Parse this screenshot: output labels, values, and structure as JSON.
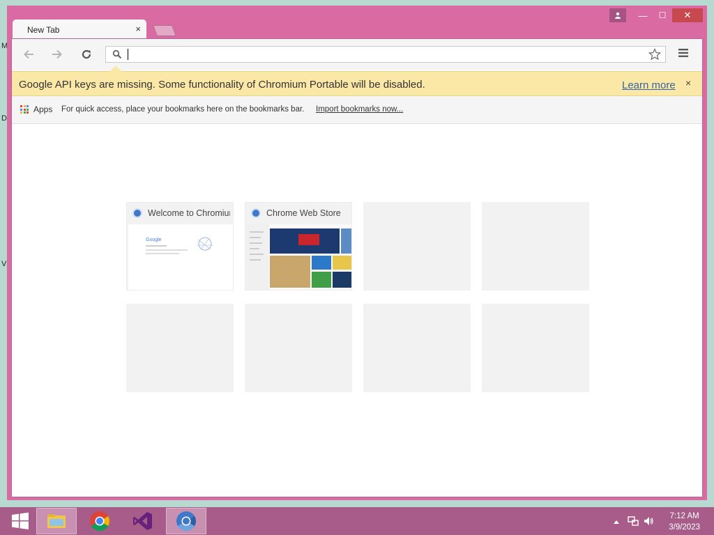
{
  "desktop": {
    "edge_letters": [
      "M",
      "D",
      "V"
    ]
  },
  "window": {
    "tab": {
      "title": "New Tab",
      "close_glyph": "×"
    },
    "controls": {
      "minimize": "—",
      "maximize": "☐",
      "close": "✕"
    }
  },
  "toolbar": {
    "omnibox": {
      "value": "",
      "placeholder": ""
    },
    "icons": {
      "back": "back-arrow-icon",
      "forward": "forward-arrow-icon",
      "reload": "reload-icon",
      "star": "star-icon",
      "menu": "hamburger-menu-icon"
    }
  },
  "infobar": {
    "message": "Google API keys are missing. Some functionality of Chromium Portable will be disabled.",
    "link": "Learn more",
    "close_glyph": "×"
  },
  "bookmarks_bar": {
    "apps_label": "Apps",
    "hint": "For quick access, place your bookmarks here on the bookmarks bar.",
    "import_link": "Import bookmarks now..."
  },
  "most_visited": {
    "tiles": [
      {
        "title": "Welcome to Chromium"
      },
      {
        "title": "Chrome Web Store"
      },
      {
        "title": ""
      },
      {
        "title": ""
      },
      {
        "title": ""
      },
      {
        "title": ""
      },
      {
        "title": ""
      },
      {
        "title": ""
      }
    ]
  },
  "taskbar": {
    "apps": [
      "file-explorer-icon",
      "chrome-icon",
      "visual-studio-icon",
      "chromium-icon"
    ],
    "clock": {
      "time": "7:12 AM",
      "date": "3/9/2023"
    }
  },
  "colors": {
    "frame": "#d96ba2",
    "taskbar": "#a75c89",
    "infobar": "#fbe8a6",
    "link": "#3465a4"
  }
}
